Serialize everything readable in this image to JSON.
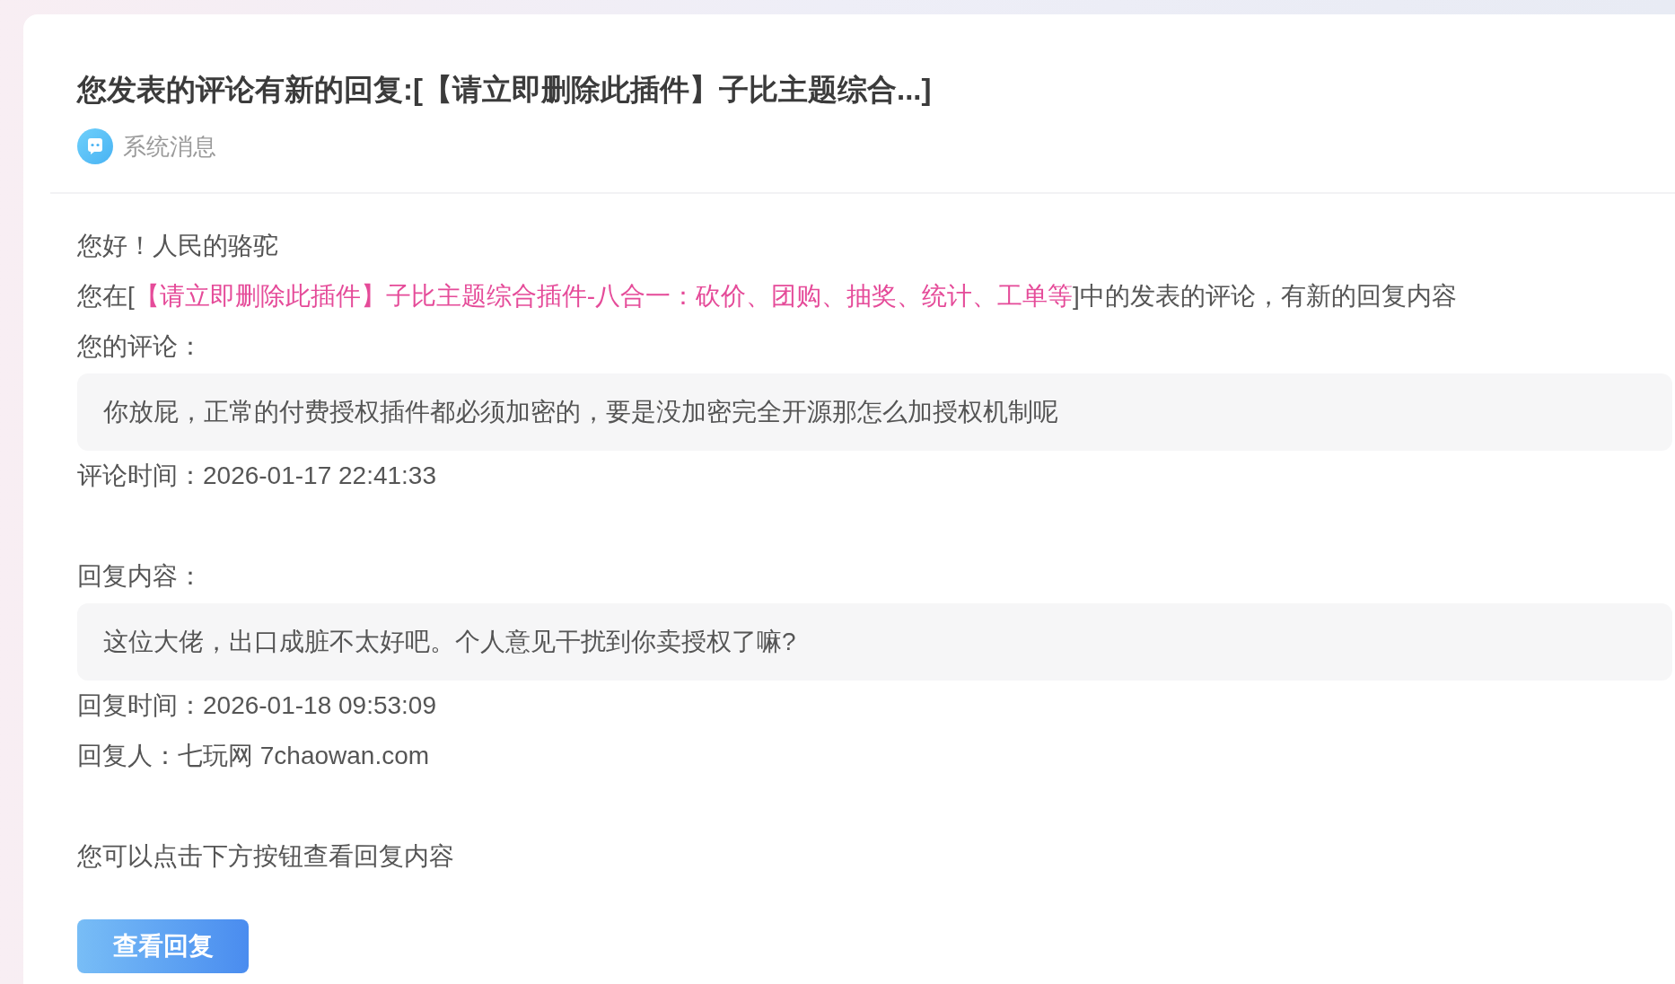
{
  "message": {
    "title": "您发表的评论有新的回复:[【请立即删除此插件】子比主题综合...]",
    "source": {
      "label": "系统消息"
    },
    "greeting": "您好！人民的骆驼",
    "intro": {
      "before": "您在[",
      "link": "【请立即删除此插件】子比主题综合插件-八合一：砍价、团购、抽奖、统计、工单等",
      "after": "]中的发表的评论，有新的回复内容"
    },
    "comment_label": "您的评论：",
    "comment": "你放屁，正常的付费授权插件都必须加密的，要是没加密完全开源那怎么加授权机制呢",
    "comment_time": "评论时间：2026-01-17 22:41:33",
    "reply_label": "回复内容：",
    "reply": "这位大佬，出口成脏不太好吧。个人意见干扰到你卖授权了嘛?",
    "reply_time": "回复时间：2026-01-18 09:53:09",
    "replier": "回复人：七玩网 7chaowan.com",
    "hint": "您可以点击下方按钮查看回复内容",
    "button": "查看回复"
  }
}
